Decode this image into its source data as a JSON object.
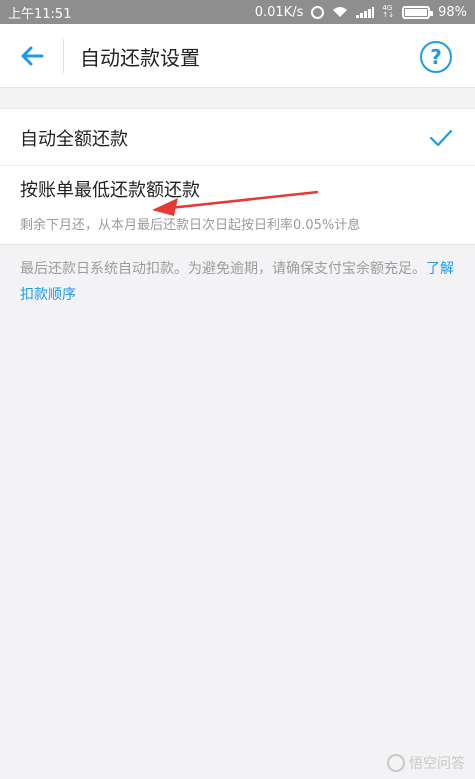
{
  "status_bar": {
    "time": "上午11:51",
    "network_speed": "0.01K/s",
    "network_type": "4G",
    "battery": "98%",
    "battery_level": 0.98
  },
  "header": {
    "title": "自动还款设置",
    "help_label": "?"
  },
  "options": {
    "full_label": "自动全额还款",
    "full_selected": true,
    "min_label": "按账单最低还款额还款",
    "min_desc": "剩余下月还，从本月最后还款日次日起按日利率0.05%计息"
  },
  "note": {
    "text": "最后还款日系统自动扣款。为避免逾期，请确保支付宝余额充足。",
    "link": "了解扣款顺序"
  },
  "watermark": {
    "text": "悟空问答"
  },
  "colors": {
    "accent": "#1e9ae8",
    "annotation": "#e53935"
  }
}
